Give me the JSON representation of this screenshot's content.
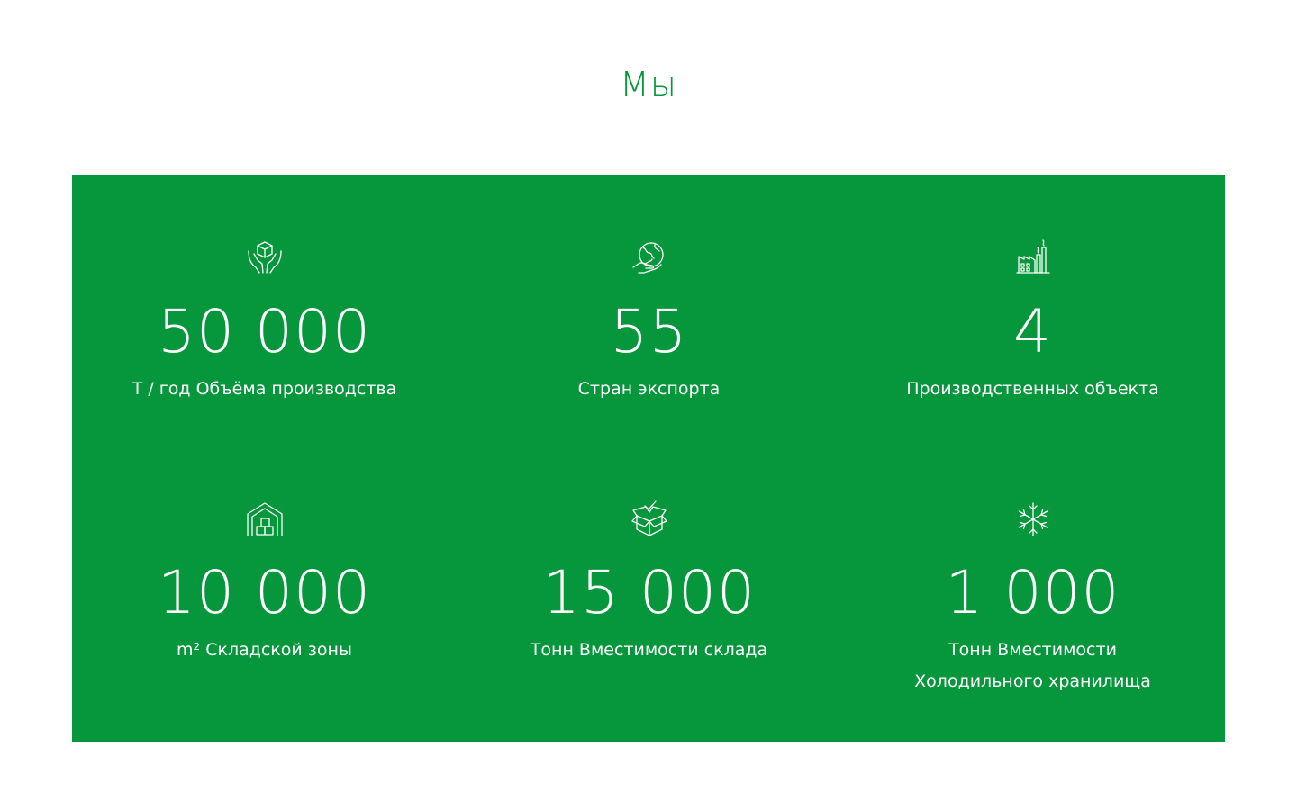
{
  "colors": {
    "accent": "#06963b",
    "panel_background": "#06963b",
    "text_on_panel": "#ffffff",
    "page_background": "#ffffff"
  },
  "section": {
    "title": "Мы"
  },
  "stats": [
    {
      "icon": "hands-box-icon",
      "number": "50 000",
      "label": "Т / год Объёма производства"
    },
    {
      "icon": "globe-hand-icon",
      "number": "55",
      "label": "Стран экспорта"
    },
    {
      "icon": "factory-icon",
      "number": "4",
      "label": "Производственных объекта"
    },
    {
      "icon": "warehouse-icon",
      "number": "10 000",
      "label": "m² Складской зоны"
    },
    {
      "icon": "open-box-check-icon",
      "number": "15 000",
      "label": "Тонн Вместимости склада"
    },
    {
      "icon": "snowflake-icon",
      "number": "1 000",
      "label": "Тонн Вместимости Холодильного хранилища"
    }
  ]
}
